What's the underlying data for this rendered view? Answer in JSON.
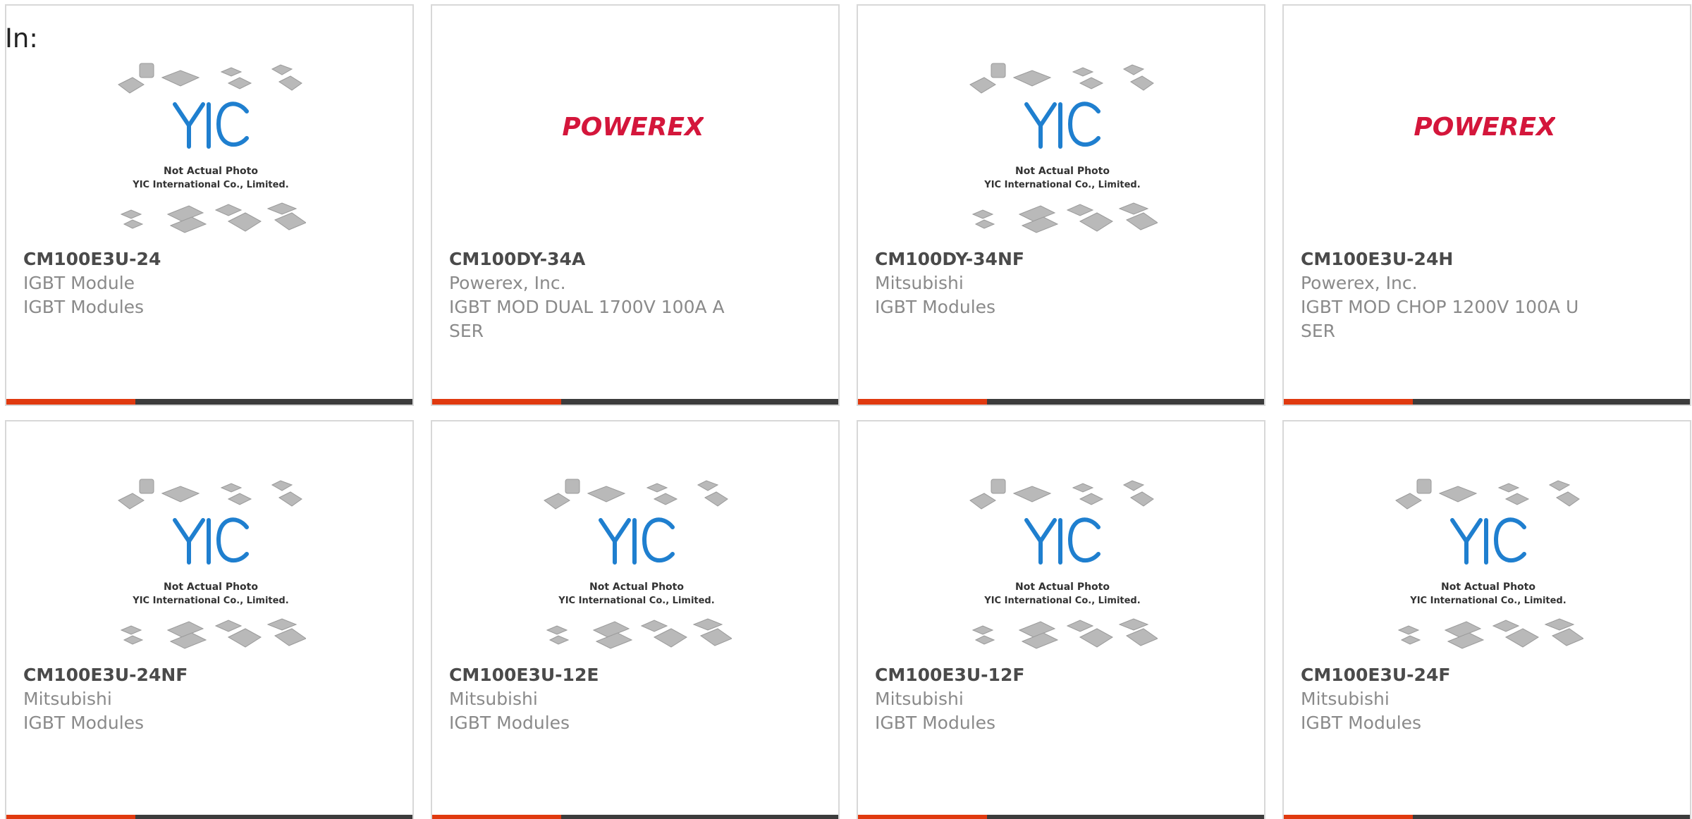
{
  "header": {
    "label": "In:"
  },
  "colors": {
    "accent": "#e0390f",
    "bar_dark": "#3c3c3c",
    "yic_blue": "#1f7fcf",
    "powerex_red": "#d4163b",
    "border": "#d8d8d8"
  },
  "placeholder": {
    "line1": "Not Actual Photo",
    "line2": "YIC International Co., Limited.",
    "logo_text": "YIC"
  },
  "brand_logo": {
    "text": "POWEREX"
  },
  "products": [
    {
      "part": "CM100E3U-24",
      "maker": "IGBT Module",
      "desc": "IGBT Modules",
      "image": "yic-placeholder"
    },
    {
      "part": "CM100DY-34A",
      "maker": "Powerex, Inc.",
      "desc": "IGBT MOD DUAL 1700V 100A A SER",
      "image": "powerex-logo"
    },
    {
      "part": "CM100DY-34NF",
      "maker": "Mitsubishi",
      "desc": "IGBT Modules",
      "image": "yic-placeholder"
    },
    {
      "part": "CM100E3U-24H",
      "maker": "Powerex, Inc.",
      "desc": "IGBT MOD CHOP 1200V 100A U SER",
      "image": "powerex-logo"
    },
    {
      "part": "CM100E3U-24NF",
      "maker": "Mitsubishi",
      "desc": "IGBT Modules",
      "image": "yic-placeholder"
    },
    {
      "part": "CM100E3U-12E",
      "maker": "Mitsubishi",
      "desc": "IGBT Modules",
      "image": "yic-placeholder"
    },
    {
      "part": "CM100E3U-12F",
      "maker": "Mitsubishi",
      "desc": "IGBT Modules",
      "image": "yic-placeholder"
    },
    {
      "part": "CM100E3U-24F",
      "maker": "Mitsubishi",
      "desc": "IGBT Modules",
      "image": "yic-placeholder"
    }
  ]
}
